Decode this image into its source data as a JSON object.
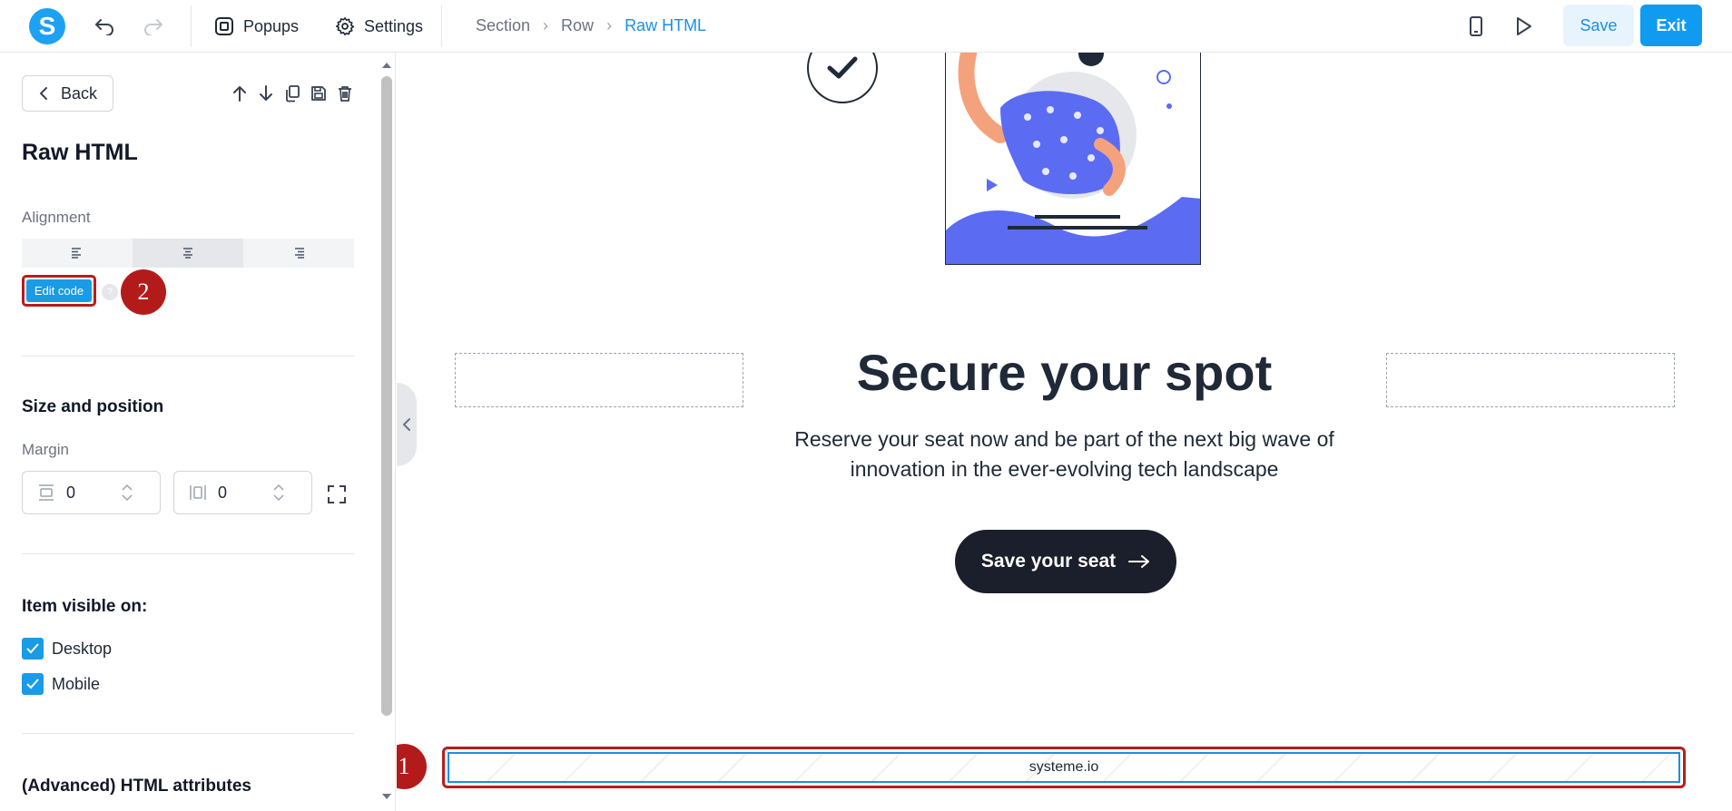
{
  "topbar": {
    "logo_letter": "S",
    "popups_label": "Popups",
    "settings_label": "Settings",
    "breadcrumb": [
      "Section",
      "Row",
      "Raw HTML"
    ],
    "save_label": "Save",
    "exit_label": "Exit"
  },
  "sidebar": {
    "back_label": "Back",
    "title": "Raw HTML",
    "alignment_label": "Alignment",
    "edit_code_label": "Edit code",
    "help_label": "?",
    "size_position_title": "Size and position",
    "margin_label": "Margin",
    "margin_top_value": "0",
    "margin_side_value": "0",
    "visible_on_title": "Item visible on:",
    "desktop_label": "Desktop",
    "mobile_label": "Mobile",
    "advanced_title": "(Advanced) HTML attributes"
  },
  "annotations": {
    "badge_1": "1",
    "badge_2": "2"
  },
  "canvas": {
    "headline": "Secure your spot",
    "subtitle_line1": "Reserve your seat now and be part of the next big wave of",
    "subtitle_line2": "innovation in the ever-evolving tech landscape",
    "cta_label": "Save your seat",
    "footer_text": "systeme.io"
  },
  "colors": {
    "accent": "#1a8fe3",
    "exit_button": "#0f9cf0",
    "annotation_red": "#b31b1b",
    "cta_bg": "#1b1f2b",
    "illustration_purple": "#5b6cf2"
  },
  "icons": [
    "undo-icon",
    "redo-icon",
    "popups-icon",
    "gear-icon",
    "mobile-preview-icon",
    "play-icon",
    "chevron-left-icon",
    "arrow-up-icon",
    "arrow-down-icon",
    "copy-icon",
    "save-icon",
    "trash-icon",
    "align-left-icon",
    "align-center-icon",
    "align-right-icon",
    "checkmark-icon",
    "arrow-right-icon"
  ]
}
